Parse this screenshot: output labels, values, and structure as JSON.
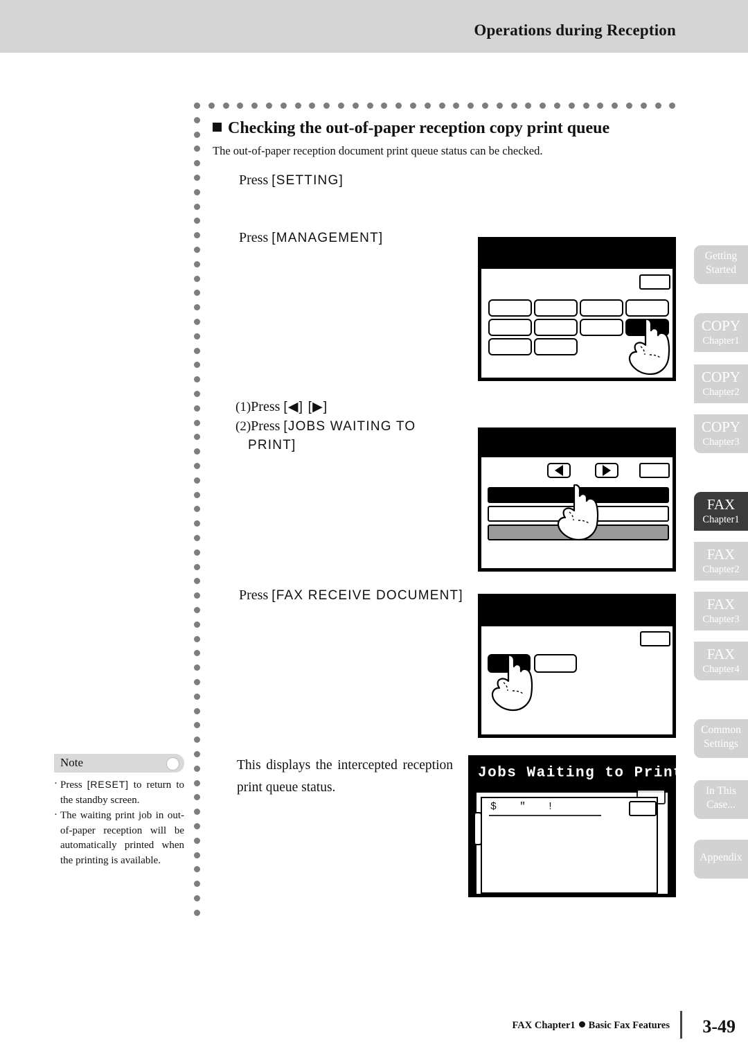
{
  "header": {
    "title": "Operations during Reception"
  },
  "section": {
    "heading": "Checking the out-of-paper reception copy print queue",
    "intro": "The out-of-paper reception document print queue status can be checked."
  },
  "steps": [
    {
      "id": "step-1",
      "press_label": "Press",
      "key": "[SETTING]"
    },
    {
      "id": "step-2",
      "press_label": "Press",
      "key": "[MANAGEMENT]"
    },
    {
      "id": "step-3a",
      "number": "(1)",
      "press_label": "Press",
      "key": "[◀] [▶]"
    },
    {
      "id": "step-3b",
      "number": "(2)",
      "press_label": "Press",
      "key": "[JOBS WAITING TO",
      "key_line2": "PRINT]"
    },
    {
      "id": "step-4",
      "press_label": "Press",
      "key": "[FAX RECEIVE DOCUMENT]"
    }
  ],
  "result_text": "This displays the intercepted reception print queue status.",
  "note": {
    "label": "Note",
    "items": [
      {
        "text_before": "Press ",
        "key": "[RESET]",
        "text_after": " to return to the standby screen."
      },
      {
        "text_before": "",
        "key": "",
        "text_after": "The waiting print job in out-of-paper reception will be automatically printed when the printing is available."
      }
    ]
  },
  "lcd_panels": [
    {
      "id": "lcd-management",
      "title": "",
      "button_rows": [
        4,
        4,
        2
      ],
      "selected": "row2-col4",
      "has_corner_button": true,
      "has_finger": true
    },
    {
      "id": "lcd-jobs-waiting",
      "title": "",
      "arrows": [
        "◀",
        "▶"
      ],
      "list_rows": [
        "selected",
        "normal",
        "gray"
      ],
      "has_corner_button": true,
      "has_finger": true
    },
    {
      "id": "lcd-fax-receive",
      "title": "",
      "button_rows": [
        2
      ],
      "selected": "row1-col1",
      "has_corner_button": true,
      "has_finger": true
    },
    {
      "id": "lcd-queue-status",
      "title": "Jobs Waiting to Print",
      "column_headers": [
        "$",
        "\"",
        "!"
      ],
      "has_corner_button": true,
      "has_finger": false
    }
  ],
  "tabs": [
    {
      "id": "tab-getting-started",
      "line1": "Getting",
      "line2": "Started",
      "style": "two-line",
      "active": false
    },
    {
      "id": "tab-copy-chapter1",
      "line1": "COPY",
      "line2": "Chapter1",
      "style": "big",
      "active": false
    },
    {
      "id": "tab-copy-chapter2",
      "line1": "COPY",
      "line2": "Chapter2",
      "style": "big",
      "active": false
    },
    {
      "id": "tab-copy-chapter3",
      "line1": "COPY",
      "line2": "Chapter3",
      "style": "big",
      "active": false
    },
    {
      "id": "tab-fax-chapter1",
      "line1": "FAX",
      "line2": "Chapter1",
      "style": "big",
      "active": true
    },
    {
      "id": "tab-fax-chapter2",
      "line1": "FAX",
      "line2": "Chapter2",
      "style": "big",
      "active": false
    },
    {
      "id": "tab-fax-chapter3",
      "line1": "FAX",
      "line2": "Chapter3",
      "style": "big",
      "active": false
    },
    {
      "id": "tab-fax-chapter4",
      "line1": "FAX",
      "line2": "Chapter4",
      "style": "big",
      "active": false
    },
    {
      "id": "tab-common-settings",
      "line1": "Common",
      "line2": "Settings",
      "style": "two-line",
      "active": false
    },
    {
      "id": "tab-in-this-case",
      "line1": "In This",
      "line2": "Case...",
      "style": "two-line",
      "active": false
    },
    {
      "id": "tab-appendix",
      "line1": "Appendix",
      "line2": "",
      "style": "one-line",
      "active": false
    }
  ],
  "footer": {
    "chapter": "FAX Chapter1",
    "feature": "Basic Fax Features",
    "page": "3-49"
  }
}
